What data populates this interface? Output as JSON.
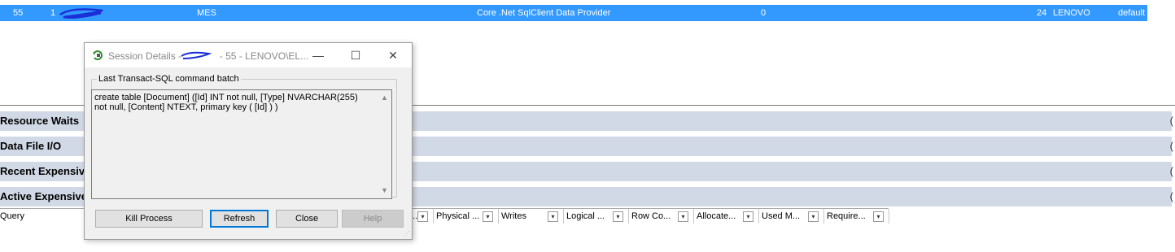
{
  "row": {
    "session_id": "55",
    "col2": "1",
    "database": "MES",
    "program": "Core .Net SqlClient Data Provider",
    "value_zero": "0",
    "host_prefix": "24",
    "host": "LENOVO",
    "pool": "default"
  },
  "sections": [
    {
      "title": "Resource Waits"
    },
    {
      "title": "Data File I/O"
    },
    {
      "title": "Recent Expensive Queries"
    },
    {
      "title": "Active Expensive Queries"
    }
  ],
  "section_toggle": "(",
  "grid": {
    "first_col": "Query",
    "partial_col": "...",
    "columns": [
      "Physical ...",
      "Writes",
      "Logical ...",
      "Row Co...",
      "Allocate...",
      "Used M...",
      "Require..."
    ],
    "dropdown_glyph": "▾"
  },
  "dialog": {
    "title_prefix": "Session Details -",
    "title_suffix": "- 55 - LENOVO\\EL...",
    "minimize": "—",
    "maximize": "☐",
    "close": "✕",
    "group_label": "Last Transact-SQL command batch",
    "sql": "create table [Document] ([Id] INT not null, [Type] NVARCHAR(255) not null, [Content] NTEXT, primary key ( [Id] ) )",
    "buttons": {
      "kill": "Kill Process",
      "refresh": "Refresh",
      "close": "Close",
      "help": "Help"
    },
    "scroll_up": "▲",
    "scroll_down": "▼"
  }
}
